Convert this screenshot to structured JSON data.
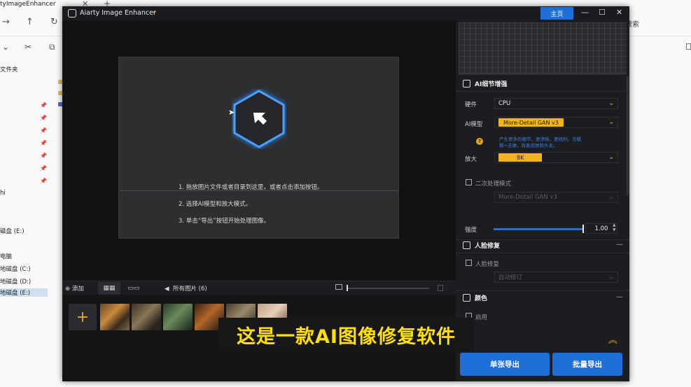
{
  "explorer": {
    "tab_title": "tyImageEnhancer",
    "search_hint": "搜索",
    "sidebar": [
      {
        "label": "文件夹"
      },
      {
        "label": "hi"
      },
      {
        "label": "磁盘 (E:)"
      },
      {
        "label": "电脑"
      },
      {
        "label": "地磁盘 (C:)"
      },
      {
        "label": "地磁盘 (D:)"
      },
      {
        "label": "地磁盘 (E:)"
      }
    ]
  },
  "app": {
    "title": "Aiarty Image Enhancer",
    "home_label": "主页",
    "drop_steps": [
      "1. 拖放图片文件或者目录到这里，或者点击添加按钮。",
      "2. 选择AI模型和放大模式。",
      "3. 单击“导出”按钮开始处理图像。"
    ],
    "thumbbar": {
      "add_label": "添加",
      "all_images_label": "所有图片 (6)"
    },
    "subtitle": "这是一款AI图像修复软件",
    "panel": {
      "detail_section": "AI细节增强",
      "hardware_label": "硬件",
      "hardware_value": "CPU",
      "model_label": "AI模型",
      "model_value": "More-Detail GAN  v3",
      "model_desc": "产生更多的细节，更清晰，更锐利。去模糊+去噪，改善皮肤和头发。",
      "upscale_label": "放大",
      "upscale_value": "8K",
      "second_pass_label": "二次处理模式",
      "second_pass_model": "More-Detail GAN  v3",
      "strength_label": "强度",
      "strength_value": "1.00",
      "strength_level": 1.0,
      "face_section": "人脸修复",
      "face_checkbox_label": "人脸修复",
      "face_select_value": "自动修订",
      "color_section": "颜色",
      "color_checkbox_label": "启用",
      "export_single": "单张导出",
      "export_batch": "批量导出"
    },
    "colors": {
      "accent_blue": "#1f6fd9",
      "accent_orange": "#f4b21c",
      "subtitle_yellow": "#ffe100"
    }
  }
}
